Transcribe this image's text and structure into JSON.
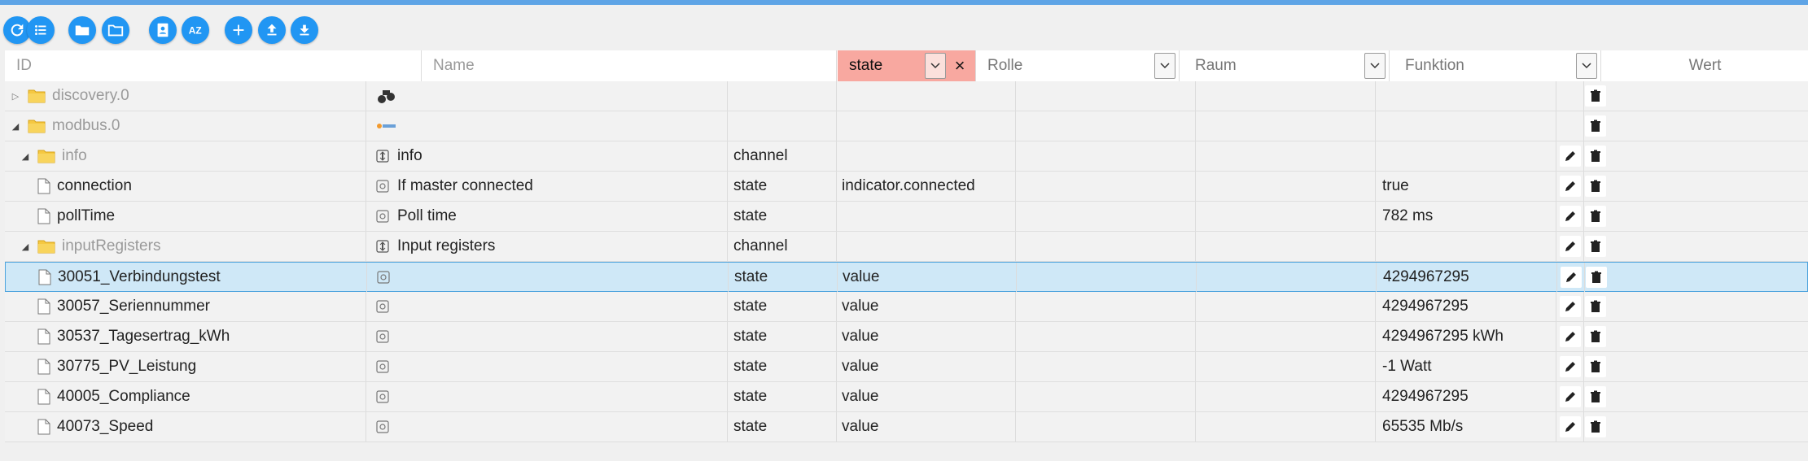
{
  "toolbar": {
    "buttons": [
      {
        "icon": "refresh-icon"
      },
      {
        "icon": "list-icon"
      },
      {
        "icon": "folder-open-icon"
      },
      {
        "icon": "folder-icon"
      },
      {
        "icon": "contact-icon"
      },
      {
        "icon": "sort-az-icon",
        "label": "AZ"
      },
      {
        "icon": "add-icon"
      },
      {
        "icon": "upload-icon"
      },
      {
        "icon": "download-icon"
      }
    ]
  },
  "filters": {
    "id_placeholder": "ID",
    "name_placeholder": "Name",
    "type_value": "state",
    "role_label": "Rolle",
    "room_label": "Raum",
    "function_label": "Funktion",
    "value_header": "Wert"
  },
  "rows": [
    {
      "id": "discovery.0",
      "name": "",
      "type": "",
      "role": "",
      "value": ""
    },
    {
      "id": "modbus.0",
      "name": "",
      "type": "",
      "role": "",
      "value": ""
    },
    {
      "id": "info",
      "name": "info",
      "type": "channel",
      "role": "",
      "value": ""
    },
    {
      "id": "connection",
      "name": "If master connected",
      "type": "state",
      "role": "indicator.connected",
      "value": "true"
    },
    {
      "id": "pollTime",
      "name": "Poll time",
      "type": "state",
      "role": "",
      "value": "782 ms"
    },
    {
      "id": "inputRegisters",
      "name": "Input registers",
      "type": "channel",
      "role": "",
      "value": ""
    },
    {
      "id": "30051_Verbindungstest",
      "name": "",
      "type": "state",
      "role": "value",
      "value": "4294967295"
    },
    {
      "id": "30057_Seriennummer",
      "name": "",
      "type": "state",
      "role": "value",
      "value": "4294967295"
    },
    {
      "id": "30537_Tagesertrag_kWh",
      "name": "",
      "type": "state",
      "role": "value",
      "value": "4294967295 kWh"
    },
    {
      "id": "30775_PV_Leistung",
      "name": "",
      "type": "state",
      "role": "value",
      "value": "-1 Watt"
    },
    {
      "id": "40005_Compliance",
      "name": "",
      "type": "state",
      "role": "value",
      "value": "4294967295"
    },
    {
      "id": "40073_Speed",
      "name": "",
      "type": "state",
      "role": "value",
      "value": "65535 Mb/s"
    }
  ],
  "colors": {
    "accent": "#2196f3",
    "selected_row": "#cfe8f7",
    "active_filter": "#f8a8a0"
  }
}
